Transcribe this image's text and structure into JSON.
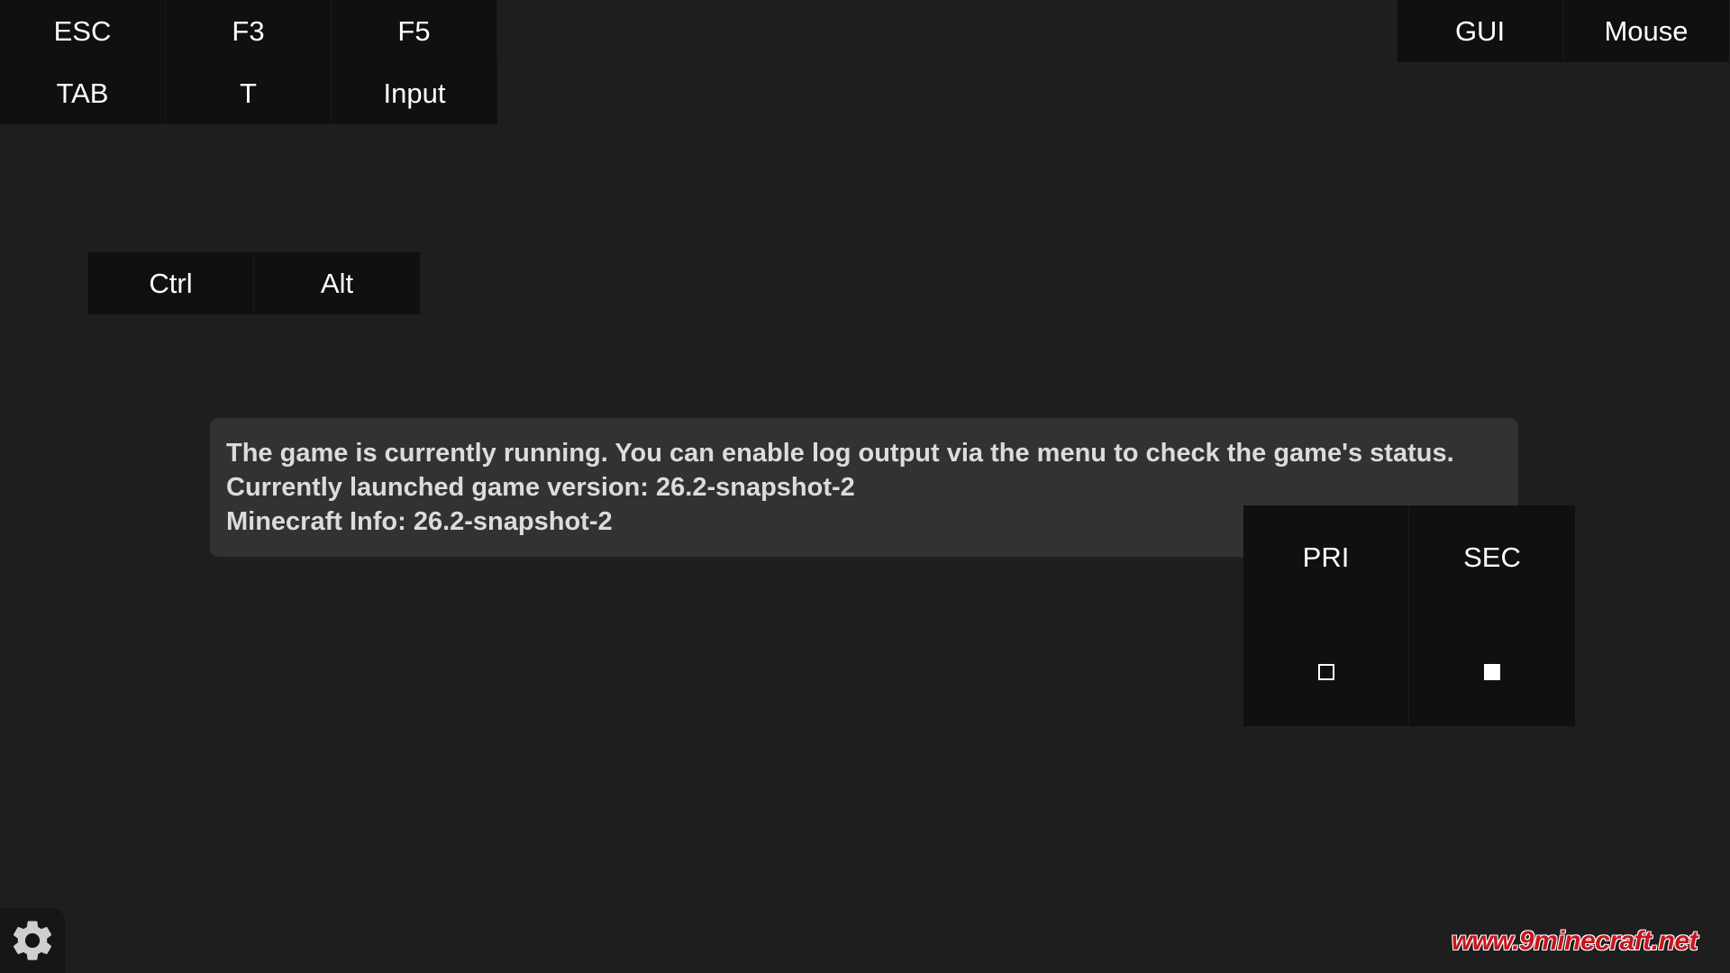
{
  "top_left_keys": {
    "row1": [
      "ESC",
      "F3",
      "F5"
    ],
    "row2": [
      "TAB",
      "T",
      "Input"
    ]
  },
  "top_right_keys": [
    "GUI",
    "Mouse"
  ],
  "modifier_keys": [
    "Ctrl",
    "Alt"
  ],
  "status": {
    "line1": "The game is currently running. You can enable log output via the menu to check the game's status.",
    "line2": "Currently launched game version: 26.2-snapshot-2",
    "line3": "Minecraft Info: 26.2-snapshot-2"
  },
  "mouse_buttons": {
    "primary": {
      "label": "PRI",
      "icon": "empty-square-icon"
    },
    "secondary": {
      "label": "SEC",
      "icon": "filled-square-icon"
    }
  },
  "settings": {
    "icon": "gear-icon"
  },
  "watermark": "www.9minecraft.net",
  "colors": {
    "background": "#1e1e1e",
    "key_background": "#101010",
    "status_box": "#323232",
    "status_text": "#dcdcdc",
    "watermark": "#c8141e"
  }
}
